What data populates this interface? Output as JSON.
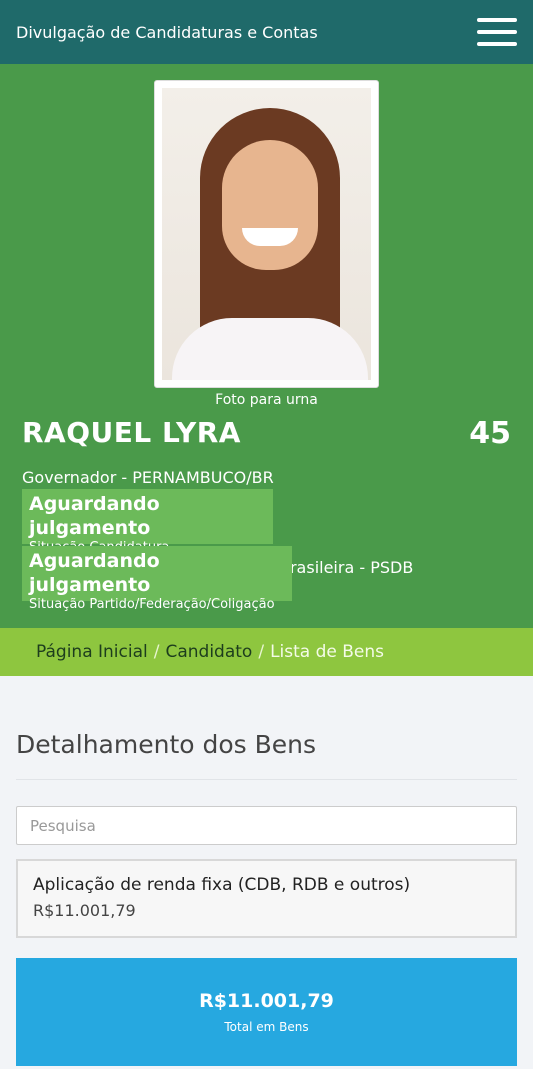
{
  "header": {
    "title": "Divulgação de Candidaturas e Contas",
    "menu_icon": "hamburger-menu-icon"
  },
  "candidate": {
    "photo_caption": "Foto para urna",
    "name": "RAQUEL LYRA",
    "number": "45",
    "role": "Governador - PERNAMBUCO/BR",
    "status_candidacy": {
      "value": "Aguardando julgamento",
      "label": "Situação Candidatura"
    },
    "party_info": "Brasileira - PSDB",
    "status_party": {
      "value": "Aguardando julgamento",
      "label": "Situação Partido/Federação/Coligação"
    }
  },
  "breadcrumb": [
    "Página Inicial",
    "Candidato",
    "Lista de Bens"
  ],
  "bens": {
    "title": "Detalhamento dos Bens",
    "search_placeholder": "Pesquisa",
    "items": [
      {
        "name": "Aplicação de renda fixa (CDB, RDB e outros)",
        "value": "R$11.001,79"
      }
    ],
    "total_value": "R$11.001,79",
    "total_label": "Total em Bens"
  },
  "colors": {
    "header": "#1f6a6a",
    "hero": "#4a9a4a",
    "status": "#6cba5a",
    "breadcrumb": "#8ec63f",
    "total": "#26a8e0"
  }
}
